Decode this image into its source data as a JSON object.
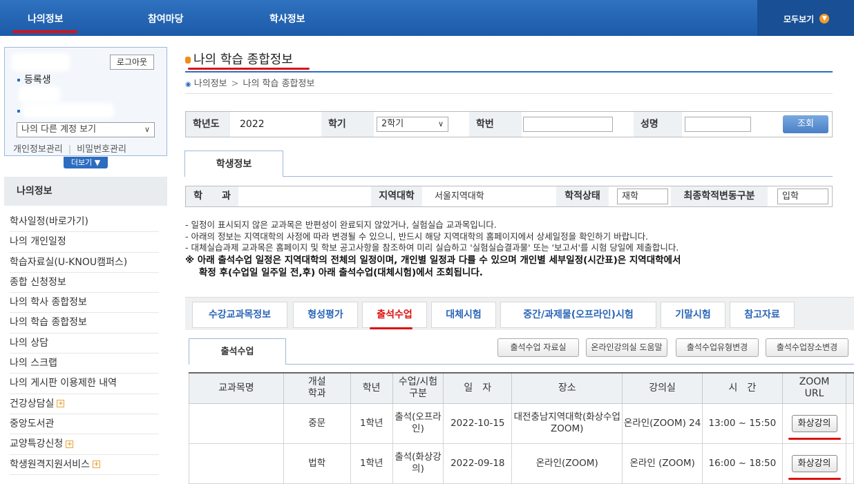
{
  "topnav": {
    "menu": [
      "나의정보",
      "참여마당",
      "학사정보"
    ],
    "all_view": "모두보기",
    "all_view_icon": "chevron-down-circle-icon"
  },
  "userbox": {
    "logout": "로그아웃",
    "status": "등록생",
    "account_select": "나의 다른 계정 보기",
    "link_profile": "개인정보관리",
    "link_password": "비밀번호관리",
    "more": "더보기"
  },
  "sidebar": {
    "title": "나의정보",
    "items": [
      {
        "label": "학사일정(바로가기)",
        "plus": false
      },
      {
        "label": "나의 개인일정",
        "plus": false
      },
      {
        "label": "학습자료실(U-KNOU캠퍼스)",
        "plus": false
      },
      {
        "label": "종합 신청정보",
        "plus": false
      },
      {
        "label": "나의 학사 종합정보",
        "plus": false
      },
      {
        "label": "나의 학습 종합정보",
        "plus": false
      },
      {
        "label": "나의 상담",
        "plus": false
      },
      {
        "label": "나의 스크랩",
        "plus": false
      },
      {
        "label": "나의 게시판 이용제한 내역",
        "plus": false
      },
      {
        "label": "건강상담실",
        "plus": true
      },
      {
        "label": "중앙도서관",
        "plus": false
      },
      {
        "label": "교양특강신청",
        "plus": true
      },
      {
        "label": "학생원격지원서비스",
        "plus": true
      }
    ]
  },
  "page": {
    "title": "나의 학습 종합정보",
    "breadcrumb": [
      "나의정보",
      "나의 학습 종합정보"
    ]
  },
  "search": {
    "year_label": "학년도",
    "year_value": "2022",
    "term_label": "학기",
    "term_value": "2학기",
    "id_label": "학번",
    "name_label": "성명",
    "button": "조회"
  },
  "student_tab": "학생정보",
  "student_info": {
    "dept_label": "학　　과",
    "region_label": "지역대학",
    "region_value": "서울지역대학",
    "status_label": "학적상태",
    "status_value": "재학",
    "change_label": "최종학적변동구분",
    "change_value": "입학"
  },
  "notes": [
    "- 일정이 표시되지 않은 교과목은 반편성이 완료되지 않았거나, 실험실습 교과목입니다.",
    "- 아래의 정보는 지역대학의 사정에 따라 변경될 수 있으니, 반드시 해당 지역대학의 홈페이지에서 상세일정을 확인하기 바랍니다.",
    "- 대체실습과제 교과목은 홈페이지 및 학보 공고사항을 참조하여 미리 실습하고 '실험실습결과물' 또는 '보고서'를 시험 당일에 제출합니다.",
    "※ 아래 출석수업 일정은 지역대학의 전체의 일정이며, 개인별 일정과 다를 수 있으며 개인별 세부일정(시간표)은 지역대학에서",
    "확정 후(수업일 일주일 전,후) 아래 출석수업(대체시험)에서 조회됩니다."
  ],
  "tabs": [
    "수강교과목정보",
    "형성평가",
    "출석수업",
    "대체시험",
    "중간/과제물(오프라인)시험",
    "기말시험",
    "참고자료"
  ],
  "active_tab": "출석수업",
  "subtab": "출석수업",
  "sub_buttons": [
    "출석수업 자료실",
    "온라인강의실 도움말",
    "출석수업유형변경",
    "출석수업장소변경"
  ],
  "table": {
    "headers": [
      "교과목명",
      "개설\n학과",
      "학년",
      "수업/시험\n구분",
      "일　자",
      "장소",
      "강의실",
      "시　간",
      "ZOOM\nURL"
    ],
    "rows": [
      {
        "course": "",
        "dept": "중문",
        "grade": "1학년",
        "type": "출석(오프라인)",
        "date": "2022-10-15",
        "place": "대전충남지역대학(화상수업ZOOM)",
        "room": "온라인(ZOOM) 24",
        "time": "13:00 ~ 15:50",
        "zoom": "화상강의"
      },
      {
        "course": "",
        "dept": "법학",
        "grade": "1학년",
        "type": "출석(화상강의)",
        "date": "2022-09-18",
        "place": "온라인(ZOOM)",
        "room": "온라인 (ZOOM)",
        "time": "16:00 ~ 18:50",
        "zoom": "화상강의"
      }
    ]
  },
  "colors": {
    "nav": "#1c5aa8",
    "accent_red": "#dd1111",
    "orange": "#f08c18"
  }
}
